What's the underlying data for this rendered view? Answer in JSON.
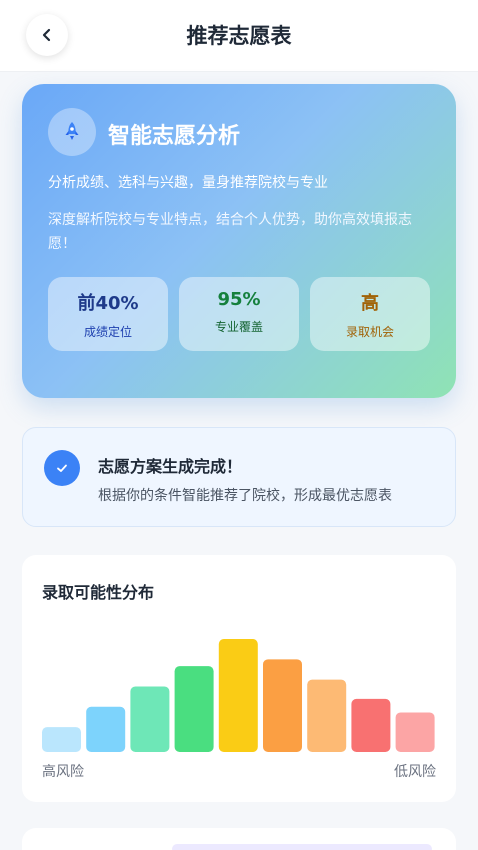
{
  "header": {
    "title": "推荐志愿表",
    "back_icon": "chevron-left-icon"
  },
  "hero": {
    "icon": "rocket-icon",
    "title": "智能志愿分析",
    "subtitle": "分析成绩、选科与兴趣，量身推荐院校与专业",
    "description": "深度解析院校与专业特点，结合个人优势，助你高效填报志愿！",
    "stats": [
      {
        "value": "前40%",
        "label": "成绩定位",
        "color": "#1e3a8a"
      },
      {
        "value": "95%",
        "label": "专业覆盖",
        "color": "#15803d"
      },
      {
        "value": "高",
        "label": "录取机会",
        "color": "#a16207"
      }
    ]
  },
  "notice": {
    "icon": "check-icon",
    "title": "志愿方案生成完成！",
    "text": "根据你的条件智能推荐了院校，形成最优志愿表"
  },
  "distribution": {
    "title": "录取可能性分布",
    "left_label": "高风险",
    "right_label": "低风险",
    "chart_data": {
      "type": "bar",
      "values": [
        22,
        40,
        58,
        76,
        100,
        82,
        64,
        47,
        35
      ],
      "colors": [
        "#bae6fd",
        "#7dd3fc",
        "#6ee7b7",
        "#4ade80",
        "#facc15",
        "#fb9f43",
        "#fdba74",
        "#f87171",
        "#fca5a5"
      ]
    }
  }
}
